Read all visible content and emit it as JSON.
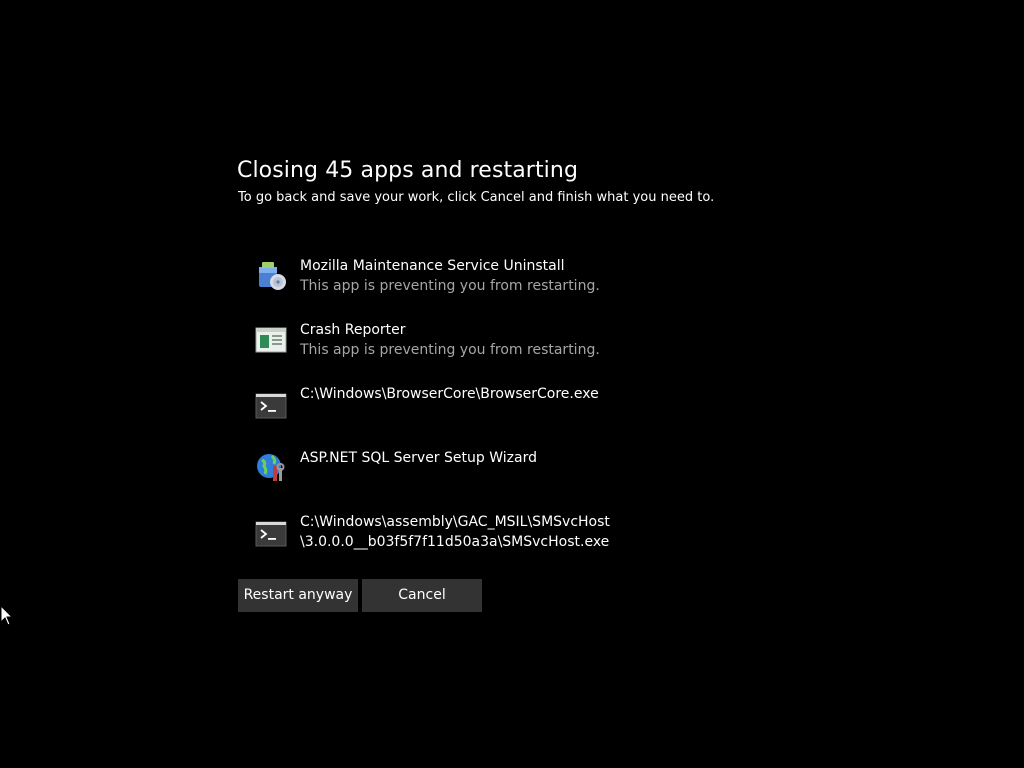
{
  "dialog": {
    "title": "Closing 45 apps and restarting",
    "subtitle": "To go back and save your work, click Cancel and finish what you need to."
  },
  "apps": [
    {
      "name": "Mozilla Maintenance Service Uninstall",
      "status": "This app is preventing you from restarting.",
      "icon": "installer-package-icon"
    },
    {
      "name": "Crash Reporter",
      "status": "This app is preventing you from restarting.",
      "icon": "application-window-icon"
    },
    {
      "name": "C:\\Windows\\BrowserCore\\BrowserCore.exe",
      "status": "",
      "icon": "console-icon"
    },
    {
      "name": "ASP.NET SQL Server Setup Wizard",
      "status": "",
      "icon": "globe-tools-icon"
    },
    {
      "name": "C:\\Windows\\assembly\\GAC_MSIL\\SMSvcHost\n\\3.0.0.0__b03f5f7f11d50a3a\\SMSvcHost.exe",
      "status": "",
      "icon": "console-icon"
    }
  ],
  "buttons": {
    "restart_label": "Restart anyway",
    "cancel_label": "Cancel"
  },
  "colors": {
    "background": "#000000",
    "text": "#ffffff",
    "secondary_text": "#a6a6a6",
    "button_bg": "#333333"
  }
}
